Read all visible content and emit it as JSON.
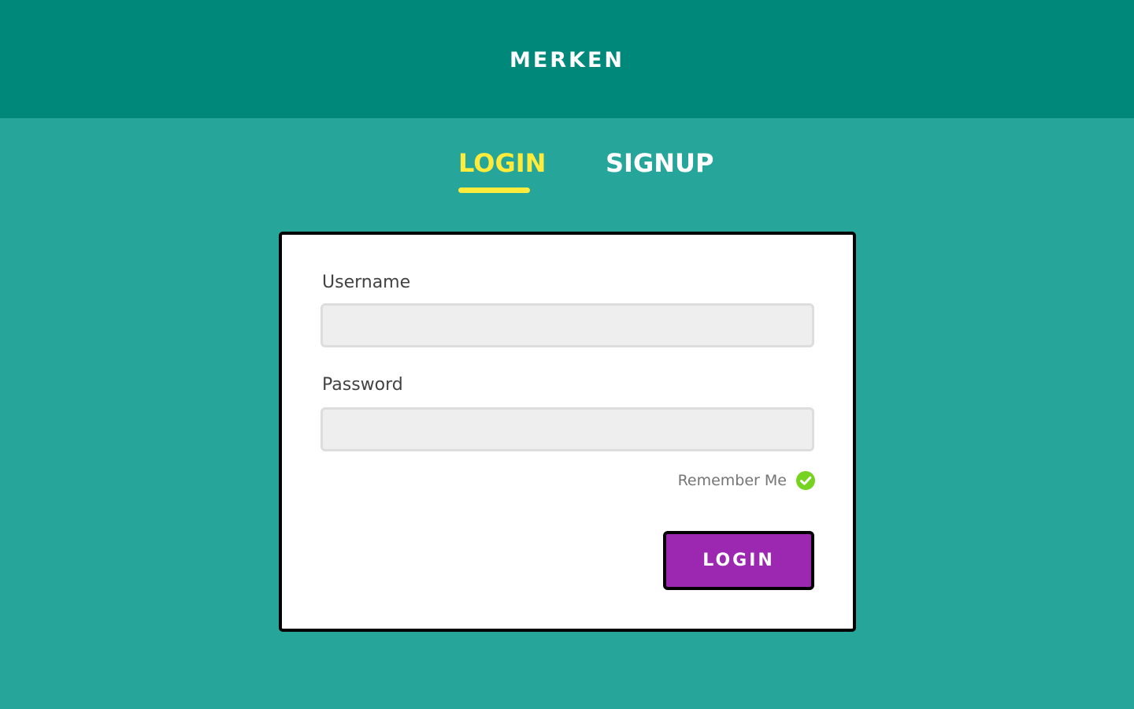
{
  "header": {
    "logo_text": "MERKEN"
  },
  "tabs": [
    {
      "label": "LOGIN",
      "active": true
    },
    {
      "label": "SIGNUP",
      "active": false
    }
  ],
  "form": {
    "username_label": "Username",
    "username_value": "",
    "password_label": "Password",
    "password_value": "",
    "remember_label": "Remember Me",
    "remember_checked": true,
    "submit_label": "LOGIN"
  },
  "icons": {
    "remember_icon": "check-circle-icon"
  },
  "colors": {
    "header_bg": "#00897b",
    "page_bg": "#26a69a",
    "active_tab": "#ffeb3b",
    "inactive_tab": "#ffffff",
    "button_bg": "#9c27b0",
    "check": "#76d320"
  }
}
